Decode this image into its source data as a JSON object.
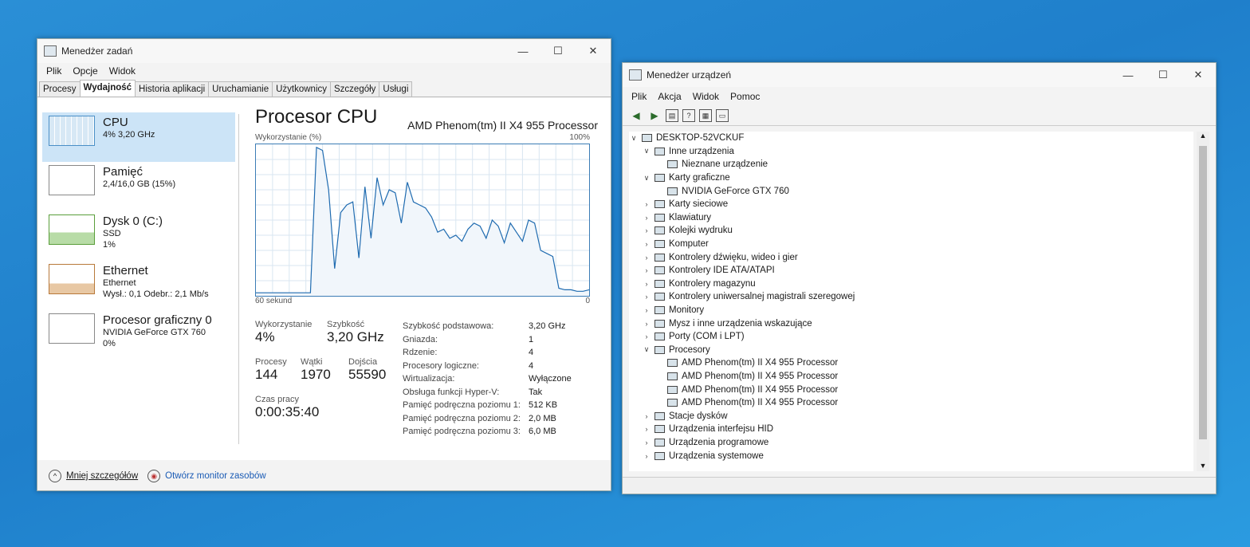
{
  "task_manager": {
    "title": "Menedżer zadań",
    "menu": [
      "Plik",
      "Opcje",
      "Widok"
    ],
    "tabs": [
      "Procesy",
      "Wydajność",
      "Historia aplikacji",
      "Uruchamianie",
      "Użytkownicy",
      "Szczegóły",
      "Usługi"
    ],
    "sidebar": [
      {
        "title": "CPU",
        "sub1": "4% 3,20 GHz",
        "sub2": "",
        "sub3": ""
      },
      {
        "title": "Pamięć",
        "sub1": "2,4/16,0 GB (15%)",
        "sub2": "",
        "sub3": ""
      },
      {
        "title": "Dysk 0 (C:)",
        "sub1": "SSD",
        "sub2": "1%",
        "sub3": ""
      },
      {
        "title": "Ethernet",
        "sub1": "Ethernet",
        "sub2": "Wysł.: 0,1 Odebr.: 2,1 Mb/s",
        "sub3": ""
      },
      {
        "title": "Procesor graficzny 0",
        "sub1": "NVIDIA GeForce GTX 760",
        "sub2": "0%",
        "sub3": ""
      }
    ],
    "main_title": "Procesor CPU",
    "cpu_model": "AMD Phenom(tm) II X4 955 Processor",
    "graph_label": "Wykorzystanie (%)",
    "graph_max": "100%",
    "graph_left_foot": "60 sekund",
    "graph_right_foot": "0",
    "stats": {
      "util_label": "Wykorzystanie",
      "util_value": "4%",
      "speed_label": "Szybkość",
      "speed_value": "3,20 GHz",
      "proc_label": "Procesy",
      "proc_value": "144",
      "threads_label": "Wątki",
      "threads_value": "1970",
      "handles_label": "Dojścia",
      "handles_value": "55590",
      "uptime_label": "Czas pracy",
      "uptime_value": "0:00:35:40"
    },
    "details": [
      {
        "k": "Szybkość podstawowa:",
        "v": "3,20 GHz"
      },
      {
        "k": "Gniazda:",
        "v": "1"
      },
      {
        "k": "Rdzenie:",
        "v": "4"
      },
      {
        "k": "Procesory logiczne:",
        "v": "4"
      },
      {
        "k": "Wirtualizacja:",
        "v": "Wyłączone"
      },
      {
        "k": "Obsługa funkcji Hyper-V:",
        "v": "Tak"
      },
      {
        "k": "Pamięć podręczna poziomu 1:",
        "v": "512 KB"
      },
      {
        "k": "Pamięć podręczna poziomu 2:",
        "v": "2,0 MB"
      },
      {
        "k": "Pamięć podręczna poziomu 3:",
        "v": "6,0 MB"
      }
    ],
    "cpu_history": [
      2,
      2,
      2,
      2,
      2,
      2,
      2,
      2,
      2,
      2,
      98,
      96,
      70,
      18,
      55,
      60,
      62,
      25,
      72,
      38,
      78,
      60,
      70,
      68,
      48,
      75,
      62,
      60,
      58,
      52,
      42,
      44,
      38,
      40,
      36,
      44,
      48,
      46,
      38,
      50,
      46,
      35,
      48,
      42,
      36,
      50,
      48,
      30,
      28,
      26,
      5,
      4,
      4,
      3,
      3,
      4
    ],
    "footer_less": "Mniej szczegółów",
    "footer_monitor": "Otwórz monitor zasobów"
  },
  "device_manager": {
    "title": "Menedżer urządzeń",
    "menu": [
      "Plik",
      "Akcja",
      "Widok",
      "Pomoc"
    ],
    "tree": [
      {
        "label": "DESKTOP-52VCKUF",
        "level": 0,
        "exp": "v"
      },
      {
        "label": "Inne urządzenia",
        "level": 1,
        "exp": "v"
      },
      {
        "label": "Nieznane urządzenie",
        "level": 2,
        "exp": ""
      },
      {
        "label": "Karty graficzne",
        "level": 1,
        "exp": "v"
      },
      {
        "label": "NVIDIA GeForce GTX 760",
        "level": 2,
        "exp": ""
      },
      {
        "label": "Karty sieciowe",
        "level": 1,
        "exp": ">"
      },
      {
        "label": "Klawiatury",
        "level": 1,
        "exp": ">"
      },
      {
        "label": "Kolejki wydruku",
        "level": 1,
        "exp": ">"
      },
      {
        "label": "Komputer",
        "level": 1,
        "exp": ">"
      },
      {
        "label": "Kontrolery dźwięku, wideo i gier",
        "level": 1,
        "exp": ">"
      },
      {
        "label": "Kontrolery IDE ATA/ATAPI",
        "level": 1,
        "exp": ">"
      },
      {
        "label": "Kontrolery magazynu",
        "level": 1,
        "exp": ">"
      },
      {
        "label": "Kontrolery uniwersalnej magistrali szeregowej",
        "level": 1,
        "exp": ">"
      },
      {
        "label": "Monitory",
        "level": 1,
        "exp": ">"
      },
      {
        "label": "Mysz i inne urządzenia wskazujące",
        "level": 1,
        "exp": ">"
      },
      {
        "label": "Porty (COM i LPT)",
        "level": 1,
        "exp": ">"
      },
      {
        "label": "Procesory",
        "level": 1,
        "exp": "v"
      },
      {
        "label": "AMD Phenom(tm) II X4 955 Processor",
        "level": 2,
        "exp": ""
      },
      {
        "label": "AMD Phenom(tm) II X4 955 Processor",
        "level": 2,
        "exp": ""
      },
      {
        "label": "AMD Phenom(tm) II X4 955 Processor",
        "level": 2,
        "exp": ""
      },
      {
        "label": "AMD Phenom(tm) II X4 955 Processor",
        "level": 2,
        "exp": ""
      },
      {
        "label": "Stacje dysków",
        "level": 1,
        "exp": ">"
      },
      {
        "label": "Urządzenia interfejsu HID",
        "level": 1,
        "exp": ">"
      },
      {
        "label": "Urządzenia programowe",
        "level": 1,
        "exp": ">"
      },
      {
        "label": "Urządzenia systemowe",
        "level": 1,
        "exp": ">"
      }
    ]
  }
}
